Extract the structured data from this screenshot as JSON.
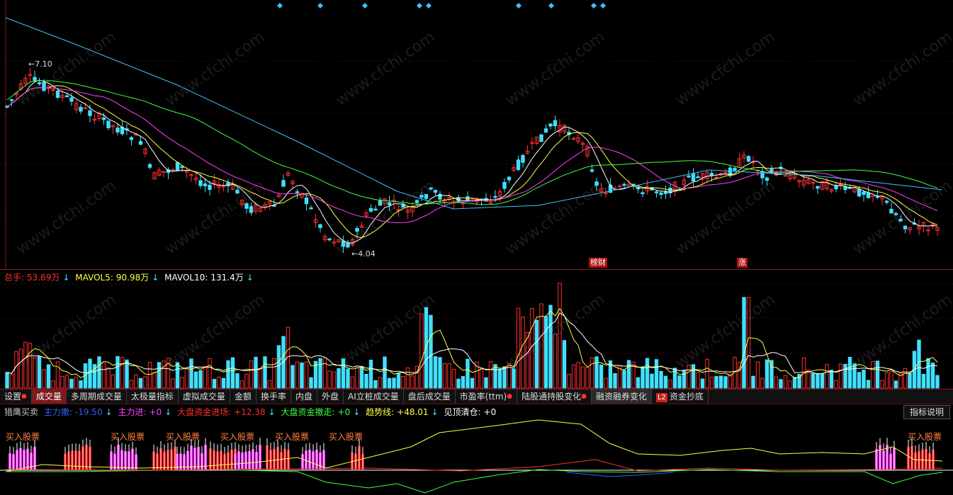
{
  "price_chart": {
    "high_label": "7.10",
    "low_label": "4.04",
    "events": [
      "榜财",
      "涨"
    ]
  },
  "volume_legend": {
    "total_label": "总手:",
    "total_value": "53.69万",
    "mavol5_label": "MAVOL5:",
    "mavol5_value": "90.98万",
    "mavol10_label": "MAVOL10:",
    "mavol10_value": "131.4万"
  },
  "tabs": [
    {
      "label": "设置",
      "dot": true
    },
    {
      "label": "成交量",
      "active": true
    },
    {
      "label": "多周期成交量"
    },
    {
      "label": "太极量指标"
    },
    {
      "label": "虚拟成交量"
    },
    {
      "label": "金额"
    },
    {
      "label": "换手率"
    },
    {
      "label": "内盘"
    },
    {
      "label": "外盘"
    },
    {
      "label": "AI立桩成交量"
    },
    {
      "label": "盘后成交量"
    },
    {
      "label": "市盈率(ttm)",
      "dot": true
    },
    {
      "label": "陆股通持股变化",
      "dot": true
    },
    {
      "label": "融资融券变化",
      "dark": true
    },
    {
      "label": "资金抄底",
      "badge": "L2"
    }
  ],
  "indicator_legend": {
    "title": "猎鹰买卖",
    "main_out_label": "主力撤:",
    "main_out_value": "-19.50",
    "main_in_label": "主力进:",
    "main_in_value": "+0",
    "market_in_label": "大盘资金进场:",
    "market_in_value": "+12.38",
    "market_out_label": "大盘资金撤走:",
    "market_out_value": "+0",
    "trend_label": "趋势线:",
    "trend_value": "+48.01",
    "clear_label": "见顶清仓:",
    "clear_value": "+0"
  },
  "indicator_button": "指标说明",
  "signal_labels": {
    "buy": "买入股票"
  },
  "colors": {
    "up": "#ff3030",
    "down": "#40e0ff",
    "ma5": "#ffffff",
    "ma10": "#ffff40",
    "ma20": "#ff40ff",
    "ma60": "#40ff40",
    "ma120": "#40c0ff"
  }
}
